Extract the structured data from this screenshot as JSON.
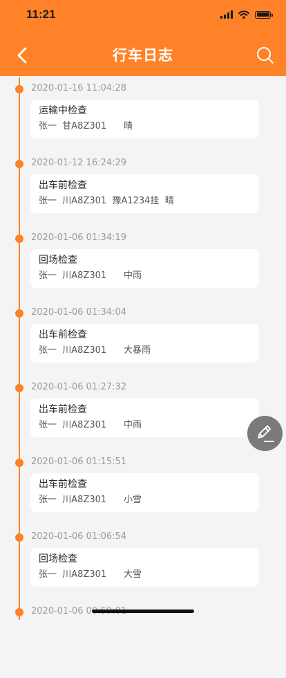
{
  "status_bar": {
    "time": "11:21"
  },
  "header": {
    "title": "行车日志",
    "back_icon": "chevron-left-icon",
    "search_icon": "search-icon"
  },
  "colors": {
    "accent": "#ff8228",
    "background": "#f4f4f4",
    "fab": "#7a7a7a"
  },
  "logs": [
    {
      "time": "2020-01-16 11:04:28",
      "title": "运输中检查",
      "driver": "张一",
      "plate": "甘A8Z301",
      "trailer": "",
      "weather": "晴"
    },
    {
      "time": "2020-01-12 16:24:29",
      "title": "出车前检查",
      "driver": "张一",
      "plate": "川A8Z301",
      "trailer": "豫A1234挂",
      "weather": "晴"
    },
    {
      "time": "2020-01-06 01:34:19",
      "title": "回场检查",
      "driver": "张一",
      "plate": "川A8Z301",
      "trailer": "",
      "weather": "中雨"
    },
    {
      "time": "2020-01-06 01:34:04",
      "title": "出车前检查",
      "driver": "张一",
      "plate": "川A8Z301",
      "trailer": "",
      "weather": "大暴雨"
    },
    {
      "time": "2020-01-06 01:27:32",
      "title": "出车前检查",
      "driver": "张一",
      "plate": "川A8Z301",
      "trailer": "",
      "weather": "中雨"
    },
    {
      "time": "2020-01-06 01:15:51",
      "title": "出车前检查",
      "driver": "张一",
      "plate": "川A8Z301",
      "trailer": "",
      "weather": "小雪"
    },
    {
      "time": "2020-01-06 01:06:54",
      "title": "回场检查",
      "driver": "张一",
      "plate": "川A8Z301",
      "trailer": "",
      "weather": "大雪"
    },
    {
      "time": "2020-01-06 00:59:01",
      "title": "",
      "driver": "",
      "plate": "",
      "trailer": "",
      "weather": ""
    }
  ],
  "fab": {
    "icon": "edit-pencil-icon"
  }
}
